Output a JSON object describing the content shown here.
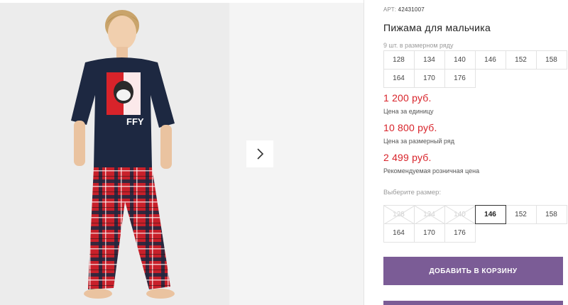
{
  "product": {
    "article_label": "АРТ:",
    "article_number": "42431007",
    "title": "Пижама для мальчика"
  },
  "size_range": {
    "caption": "9 шт. в размерном ряду",
    "sizes": [
      "128",
      "134",
      "140",
      "146",
      "152",
      "158",
      "164",
      "170",
      "176"
    ]
  },
  "prices": {
    "unit_price": "1 200 руб.",
    "unit_label": "Цена за единицу",
    "range_price": "10 800 руб.",
    "range_label": "Цена за размерный ряд",
    "retail_price": "2 499 руб.",
    "retail_label": "Рекомендуемая розничная цена"
  },
  "size_picker": {
    "label": "Выберите размер:",
    "sizes": [
      {
        "value": "128",
        "state": "disabled"
      },
      {
        "value": "134",
        "state": "disabled"
      },
      {
        "value": "140",
        "state": "disabled"
      },
      {
        "value": "146",
        "state": "selected"
      },
      {
        "value": "152",
        "state": "available"
      },
      {
        "value": "158",
        "state": "available"
      },
      {
        "value": "164",
        "state": "available"
      },
      {
        "value": "170",
        "state": "available"
      },
      {
        "value": "176",
        "state": "available"
      }
    ]
  },
  "actions": {
    "add_to_cart": "ДОБАВИТЬ В КОРЗИНУ"
  },
  "gallery": {
    "next_icon": "chevron-right-icon",
    "print_text": "FFY"
  },
  "colors": {
    "price_red": "#d8232a",
    "button_purple": "#7b5c96",
    "tshirt_navy": "#1d2841",
    "plaid_red": "#c8202a"
  }
}
